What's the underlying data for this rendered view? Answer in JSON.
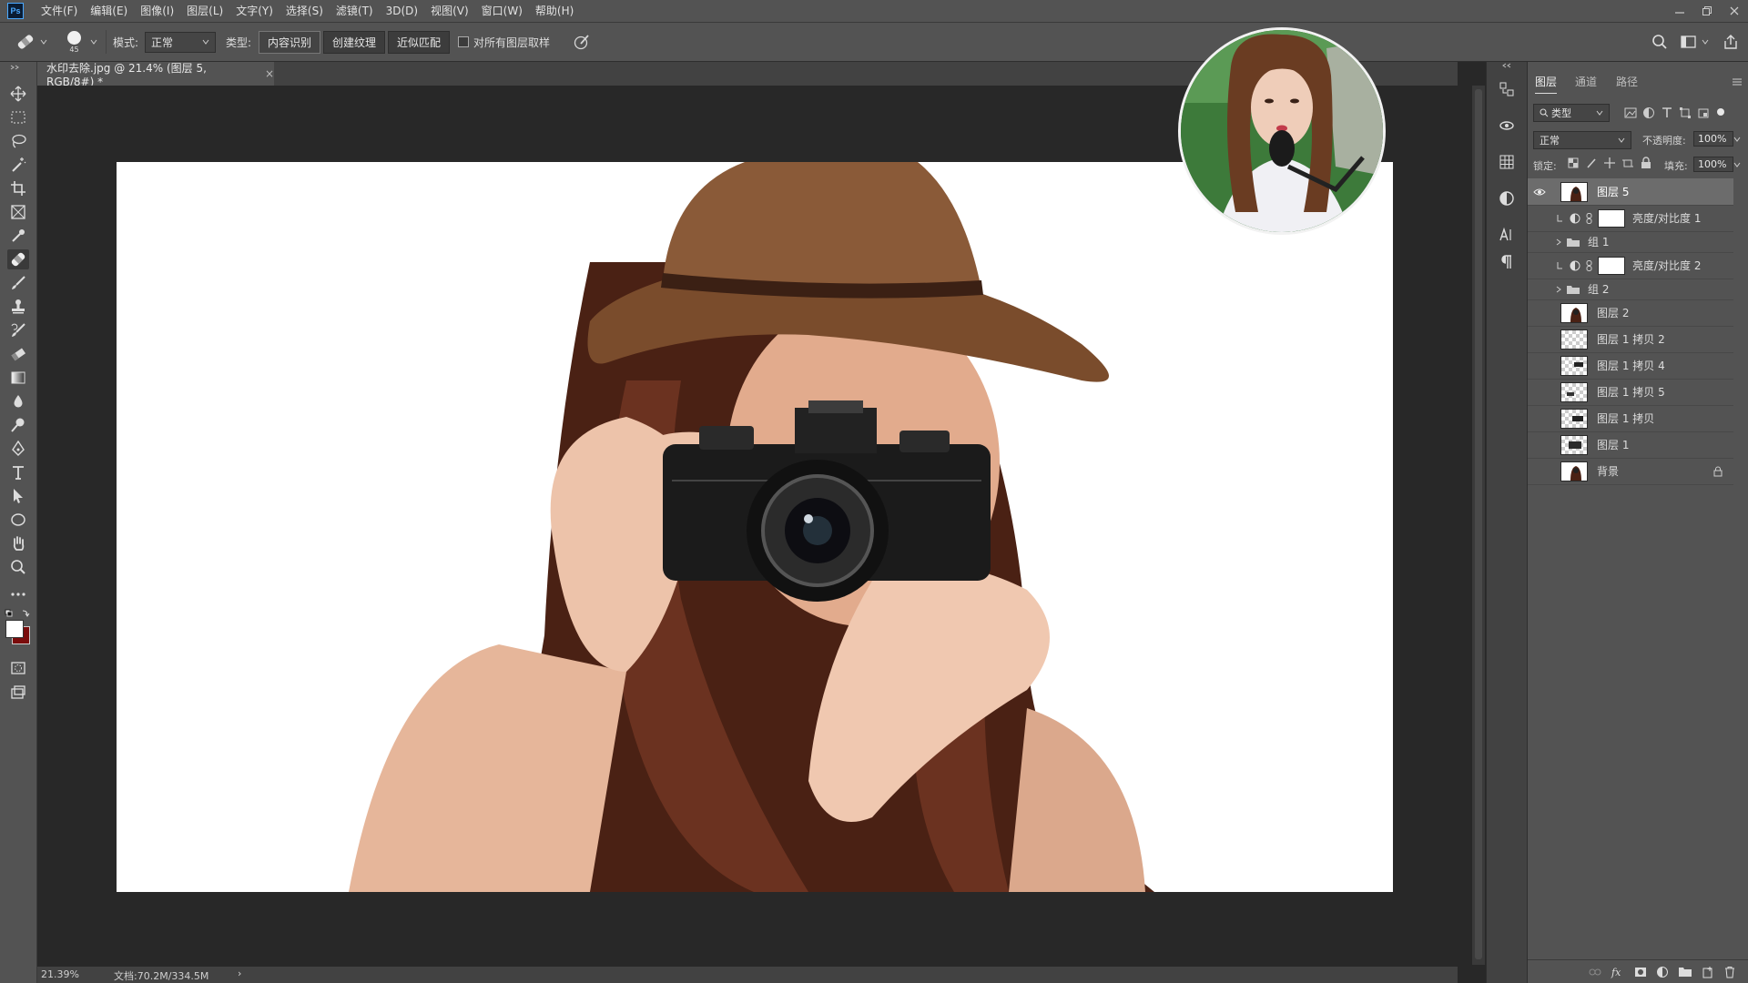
{
  "app": {
    "logo_text": "Ps"
  },
  "menu": [
    "文件(F)",
    "编辑(E)",
    "图像(I)",
    "图层(L)",
    "文字(Y)",
    "选择(S)",
    "滤镜(T)",
    "3D(D)",
    "视图(V)",
    "窗口(W)",
    "帮助(H)"
  ],
  "options": {
    "brush_size": "45",
    "mode_label": "模式:",
    "mode_value": "正常",
    "type_label": "类型:",
    "type_buttons": [
      "内容识别",
      "创建纹理",
      "近似匹配"
    ],
    "sample_all_layers": "对所有图层取样"
  },
  "document": {
    "tab_title": "水印去除.jpg @ 21.4% (图层 5, RGB/8#) *",
    "close": "×"
  },
  "status": {
    "zoom": "21.39%",
    "doc_size": "文档:70.2M/334.5M",
    "arrow": "›"
  },
  "panel": {
    "tabs": [
      "图层",
      "通道",
      "路径"
    ],
    "filter_label": "类型",
    "blend_mode": "正常",
    "opacity_label": "不透明度:",
    "opacity_value": "100%",
    "lock_label": "锁定:",
    "fill_label": "填充:",
    "fill_value": "100%"
  },
  "layers": [
    {
      "name": "图层 5",
      "kind": "image",
      "selected": true,
      "visible": true
    },
    {
      "name": "亮度/对比度 1",
      "kind": "adjustment"
    },
    {
      "name": "组 1",
      "kind": "group"
    },
    {
      "name": "亮度/对比度 2",
      "kind": "adjustment"
    },
    {
      "name": "组 2",
      "kind": "group"
    },
    {
      "name": "图层 2",
      "kind": "image"
    },
    {
      "name": "图层 1 拷贝 2",
      "kind": "transparent"
    },
    {
      "name": "图层 1 拷贝 4",
      "kind": "transparent"
    },
    {
      "name": "图层 1 拷贝 5",
      "kind": "transparent"
    },
    {
      "name": "图层 1 拷贝",
      "kind": "transparent"
    },
    {
      "name": "图层 1",
      "kind": "transparent"
    },
    {
      "name": "背景",
      "kind": "image",
      "locked": true
    }
  ],
  "colors": {
    "ui_bg": "#535353",
    "canvas_bg": "#282828",
    "accent": "#4aa8ff",
    "hat": "#8a5a38",
    "hair": "#5a2a18"
  }
}
